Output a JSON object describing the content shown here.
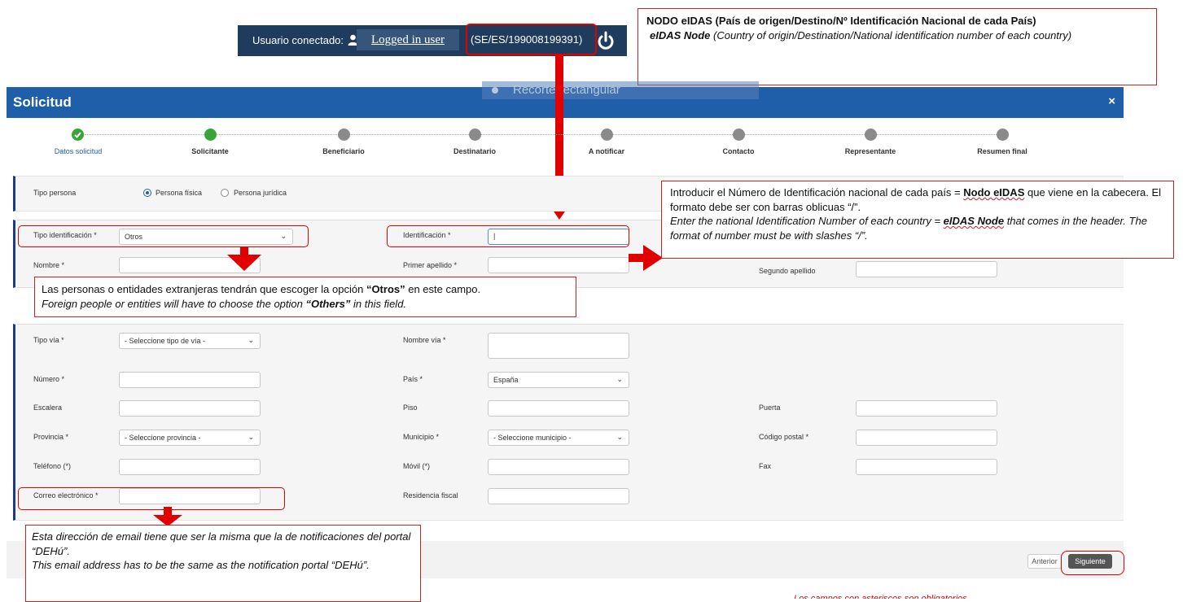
{
  "userbar": {
    "connected_label": "Usuario conectado:",
    "logged_in": "Logged in user",
    "node": "(SE/ES/199008199391)"
  },
  "note_node": {
    "line1": "NODO eIDAS (País de origen/Destino/Nº Identificación Nacional de cada País)",
    "line2_bold": "eIDAS Node",
    "line2_rest": " (Country of origin/Destination/National identification number of each country)"
  },
  "modal": {
    "title": "Solicitud",
    "close": "×",
    "ghost": "Recorte rectangular"
  },
  "steps": [
    {
      "label": "Datos solicitud",
      "state": "done"
    },
    {
      "label": "Solicitante",
      "state": "current"
    },
    {
      "label": "Beneficiario",
      "state": "todo"
    },
    {
      "label": "Destinatario",
      "state": "todo"
    },
    {
      "label": "A notificar",
      "state": "todo"
    },
    {
      "label": "Contacto",
      "state": "todo"
    },
    {
      "label": "Representante",
      "state": "todo"
    },
    {
      "label": "Resumen final",
      "state": "todo"
    }
  ],
  "persona": {
    "tipo_label": "Tipo persona",
    "fisica": "Persona física",
    "juridica": "Persona jurídica"
  },
  "ident": {
    "tipo_label": "Tipo identificación *",
    "tipo_value": "Otros",
    "ident_label": "Identificación *",
    "nombre_label": "Nombre *",
    "apellido1_label": "Primer apellido *",
    "apellido2_label": "Segundo apellido"
  },
  "note_ident": {
    "l1a": "Introducir el Número  de Identificación nacional de cada país = ",
    "l1b": "Nodo eIDAS",
    "l1c": " que viene en la cabecera. El formato debe ser con barras oblicuas “/”.",
    "l2a": "Enter the national Identification Number of each country = ",
    "l2b": "eIDAS Node",
    "l2c": " that comes in the header. The format of number must be with slashes “/”."
  },
  "note_otros": {
    "l1a": "Las personas o entidades extranjeras tendrán que escoger la opción ",
    "l1b": "“Otros”",
    "l1c": " en este campo.",
    "l2a": "Foreign people or entities will have to choose the option ",
    "l2b": "“Others”",
    "l2c": " in this field."
  },
  "address": {
    "tipo_via_label": "Tipo vía *",
    "tipo_via_value": "- Seleccione tipo de vía -",
    "nombre_via_label": "Nombre vía *",
    "numero_label": "Número *",
    "pais_label": "País *",
    "pais_value": "España",
    "escalera_label": "Escalera",
    "piso_label": "Piso",
    "puerta_label": "Puerta",
    "provincia_label": "Provincia *",
    "provincia_value": "- Seleccione provincia -",
    "municipio_label": "Municipio *",
    "municipio_value": "- Seleccione municipio -",
    "cp_label": "Código postal *",
    "telefono_label": "Teléfono (*)",
    "movil_label": "Móvil (*)",
    "fax_label": "Fax",
    "correo_label": "Correo electrónico *",
    "residencia_label": "Residencia fiscal"
  },
  "note_email": {
    "l1": "Esta dirección de email tiene que ser la misma que la de notificaciones del portal “DEHú”.",
    "l2": "This email  address has to be the same as the notification portal “DEHú”."
  },
  "footer": {
    "anterior": "Anterior",
    "siguiente": "Siguiente",
    "cut_text": "Los campos con asteriscos son obligatorios"
  },
  "colors": {
    "header": "#1f5ea8",
    "annotation_red": "#e00000",
    "step_green": "#38a538"
  }
}
